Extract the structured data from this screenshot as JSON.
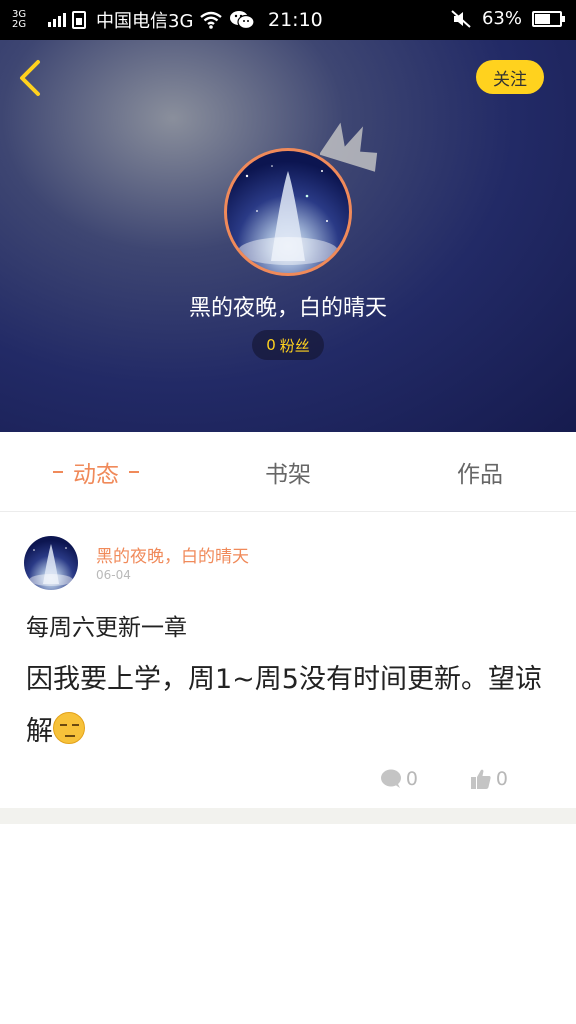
{
  "status_bar": {
    "network_top": "3G",
    "network_bottom": "2G",
    "carrier": "中国电信3G",
    "time": "21:10",
    "battery": "63%",
    "battery_level": 0.63
  },
  "header": {
    "follow_label": "关注",
    "username": "黑的夜晚，白的晴天",
    "fans_count": "0",
    "fans_label": "粉丝"
  },
  "tabs": [
    {
      "label": "动态",
      "active": true
    },
    {
      "label": "书架",
      "active": false
    },
    {
      "label": "作品",
      "active": false
    }
  ],
  "post": {
    "author": "黑的夜晚，白的晴天",
    "date": "06-04",
    "line1": "每周六更新一章",
    "line2": "因我要上学，周1~周5没有时间更新。望谅解",
    "comments": "0",
    "likes": "0"
  },
  "colors": {
    "accent": "#f08a5a",
    "follow": "#ffd21e"
  }
}
